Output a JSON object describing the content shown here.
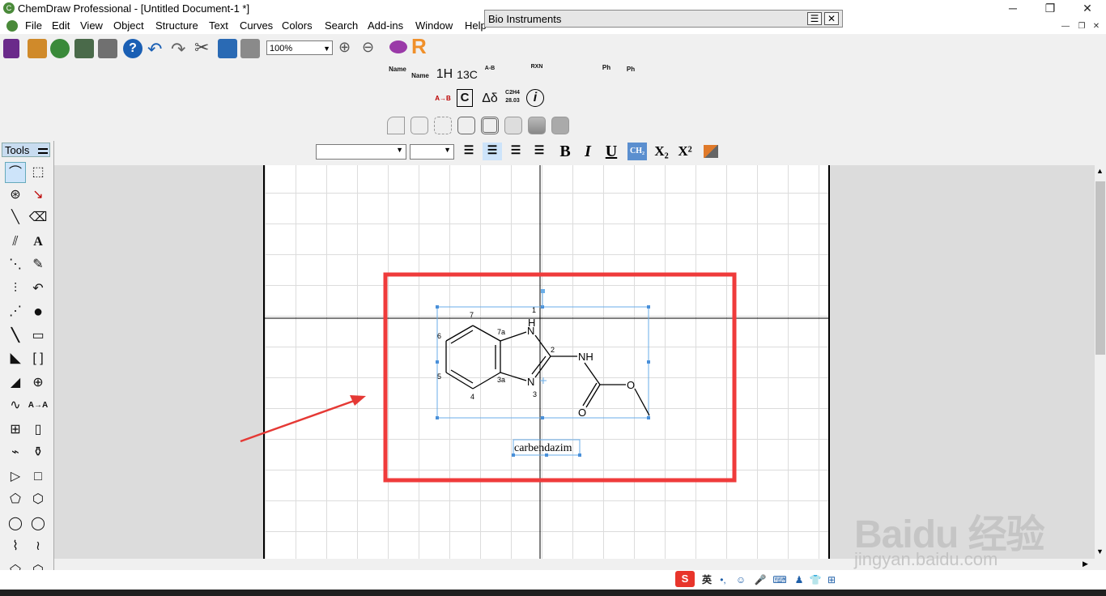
{
  "window": {
    "title": "ChemDraw Professional - [Untitled Document-1 *]",
    "controls": [
      "─",
      "❐",
      "✕"
    ],
    "mdi_controls": [
      "—",
      "❐",
      "✕"
    ]
  },
  "menu": [
    "File",
    "Edit",
    "View",
    "Object",
    "Structure",
    "Text",
    "Curves",
    "Colors",
    "Search",
    "Add-ins",
    "Window",
    "Help"
  ],
  "toolbar": {
    "zoom_value": "100%"
  },
  "bio_instruments": {
    "title": "Bio Instruments"
  },
  "chem_toolbar": {
    "row1": [
      "Name",
      "Name",
      "1H",
      "13C",
      "A-B",
      "",
      "RXN",
      "",
      "",
      "Ph",
      "Ph"
    ],
    "row2": [
      "",
      "",
      "A→B",
      "C",
      "Δδ",
      "C2H4 28.03",
      "i",
      "",
      ""
    ]
  },
  "format_bar": {
    "bold": "B",
    "italic": "I",
    "underline": "U",
    "ch2": "CH₂",
    "subscript": "X₂",
    "superscript": "X²"
  },
  "tools": {
    "header": "Tools"
  },
  "molecule": {
    "caption": "carbendazim",
    "atom_labels": {
      "H": "H",
      "N1": "N",
      "N3": "N",
      "NH": "NH",
      "O_ester": "O",
      "O_carbonyl": "O"
    },
    "locants": {
      "l1": "1",
      "l2": "2",
      "l3": "3",
      "l3a": "3a",
      "l4": "4",
      "l5": "5",
      "l6": "6",
      "l7": "7",
      "l7a": "7a"
    }
  },
  "watermark": {
    "brand": "Baidu 经验",
    "url": "jingyan.baidu.com"
  },
  "ime": {
    "lang": "英"
  },
  "colors": {
    "highlight_box": "#ef3b3b",
    "arrow": "#e53935",
    "selection": "#4a90d9"
  }
}
